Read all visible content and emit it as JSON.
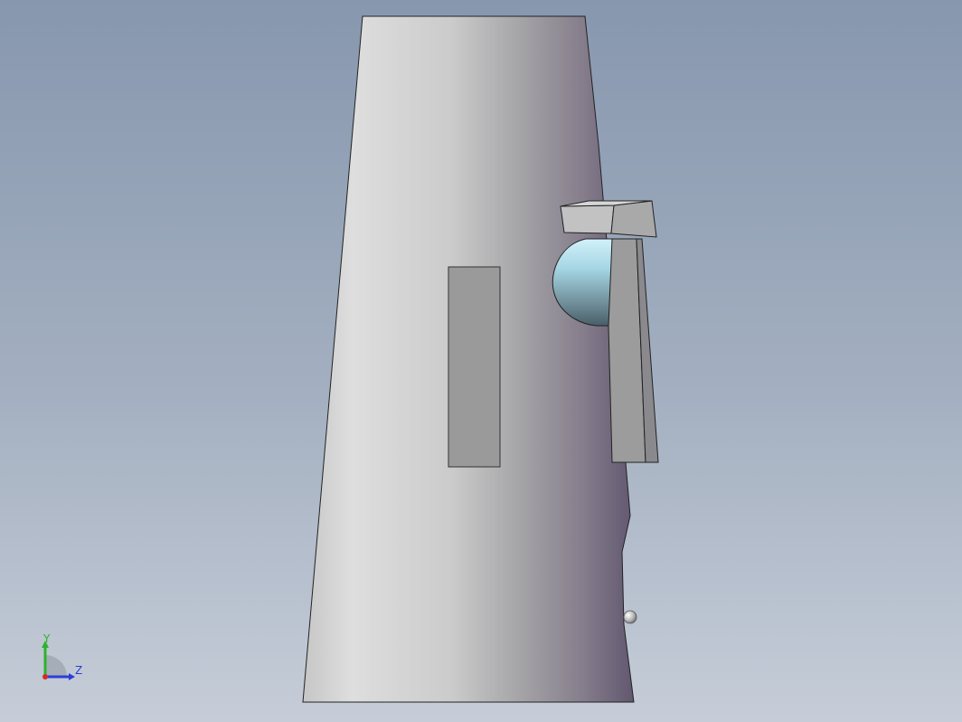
{
  "triad": {
    "y_label": "Y",
    "z_label": "Z",
    "y_color": "#2cb32c",
    "z_color": "#2a3fd6",
    "x_color": "#d62a2a"
  },
  "colors": {
    "background_top": "#8797ae",
    "background_bottom": "#c6cdd8",
    "body_light": "#dcdcdc",
    "body_dark": "#6e6478",
    "cutout_face": "#999999",
    "lens_light": "#c6ecf7",
    "lens_dark": "#4a6470"
  }
}
